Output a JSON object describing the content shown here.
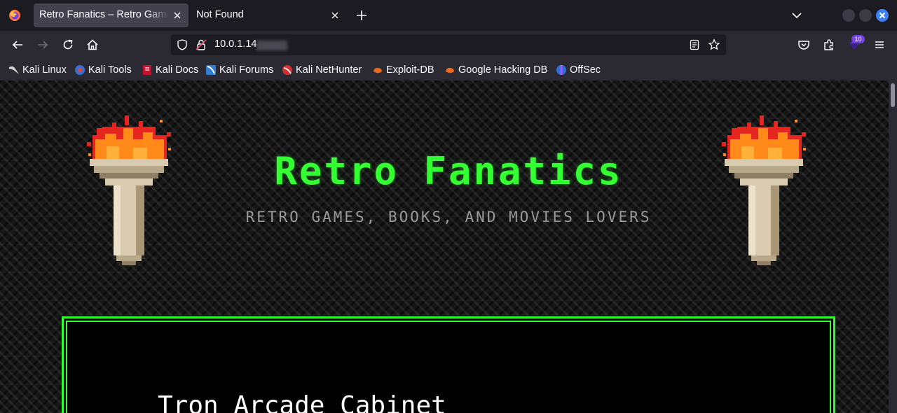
{
  "browser": {
    "tabs": [
      {
        "title": "Retro Fanatics – Retro Games, Books, and Movies Lovers",
        "active": true
      },
      {
        "title": "Not Found",
        "active": false
      }
    ],
    "url": {
      "host": "10.0.1.14"
    },
    "extensions_badge": "10",
    "bookmarks": [
      {
        "label": "Kali Linux",
        "icon": "kali-dragon-icon"
      },
      {
        "label": "Kali Tools",
        "icon": "kali-tools-icon"
      },
      {
        "label": "Kali Docs",
        "icon": "kali-docs-icon"
      },
      {
        "label": "Kali Forums",
        "icon": "kali-forums-icon"
      },
      {
        "label": "Kali NetHunter",
        "icon": "kali-nethunter-icon"
      },
      {
        "label": "Exploit-DB",
        "icon": "exploit-db-icon"
      },
      {
        "label": "Google Hacking DB",
        "icon": "google-hacking-db-icon"
      },
      {
        "label": "OffSec",
        "icon": "offsec-icon"
      }
    ],
    "colors": {
      "chrome_dark": "#1c1b22",
      "toolbar": "#2b2a33",
      "active_tab": "#42414d",
      "close_button": "#3b82f6"
    }
  },
  "site": {
    "title": "Retro Fanatics",
    "subtitle": "RETRO GAMES, BOOKS, AND MOVIES LOVERS",
    "first_post_title": "Tron Arcade Cabinet",
    "colors": {
      "accent_green": "#33ff33",
      "subtitle_gray": "#9a9a9a",
      "panel_bg": "#000000"
    }
  }
}
